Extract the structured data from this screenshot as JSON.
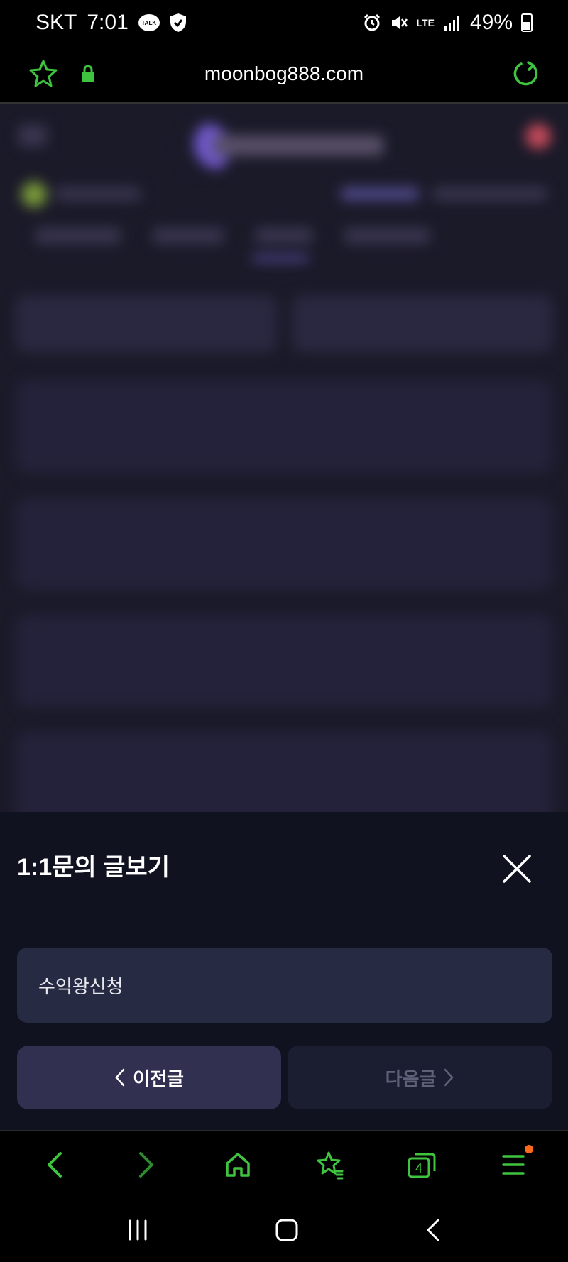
{
  "status_bar": {
    "carrier": "SKT",
    "time": "7:01",
    "talk_badge": "TALK",
    "network": "LTE",
    "battery": "49%"
  },
  "url_bar": {
    "url": "moonbog888.com"
  },
  "sheet": {
    "title": "1:1문의 글보기",
    "subject": "수익왕신청",
    "prev_label": "이전글",
    "next_label": "다음글"
  },
  "browser_toolbar": {
    "tabs_count": "4"
  },
  "colors": {
    "accent_green": "#3fc43f",
    "sheet_bg": "#10121f",
    "subject_bg": "#262a42",
    "prev_bg": "#323050",
    "next_bg": "#1b1d30",
    "notify_dot": "#ff6a1a"
  },
  "icons": [
    "star-icon",
    "lock-icon",
    "reload-icon",
    "close-icon",
    "chevron-left-icon",
    "chevron-right-icon",
    "back-icon",
    "forward-icon",
    "home-icon",
    "bookmarks-icon",
    "tabs-icon",
    "menu-icon",
    "recents-icon",
    "home-circle-icon",
    "system-back-icon"
  ]
}
